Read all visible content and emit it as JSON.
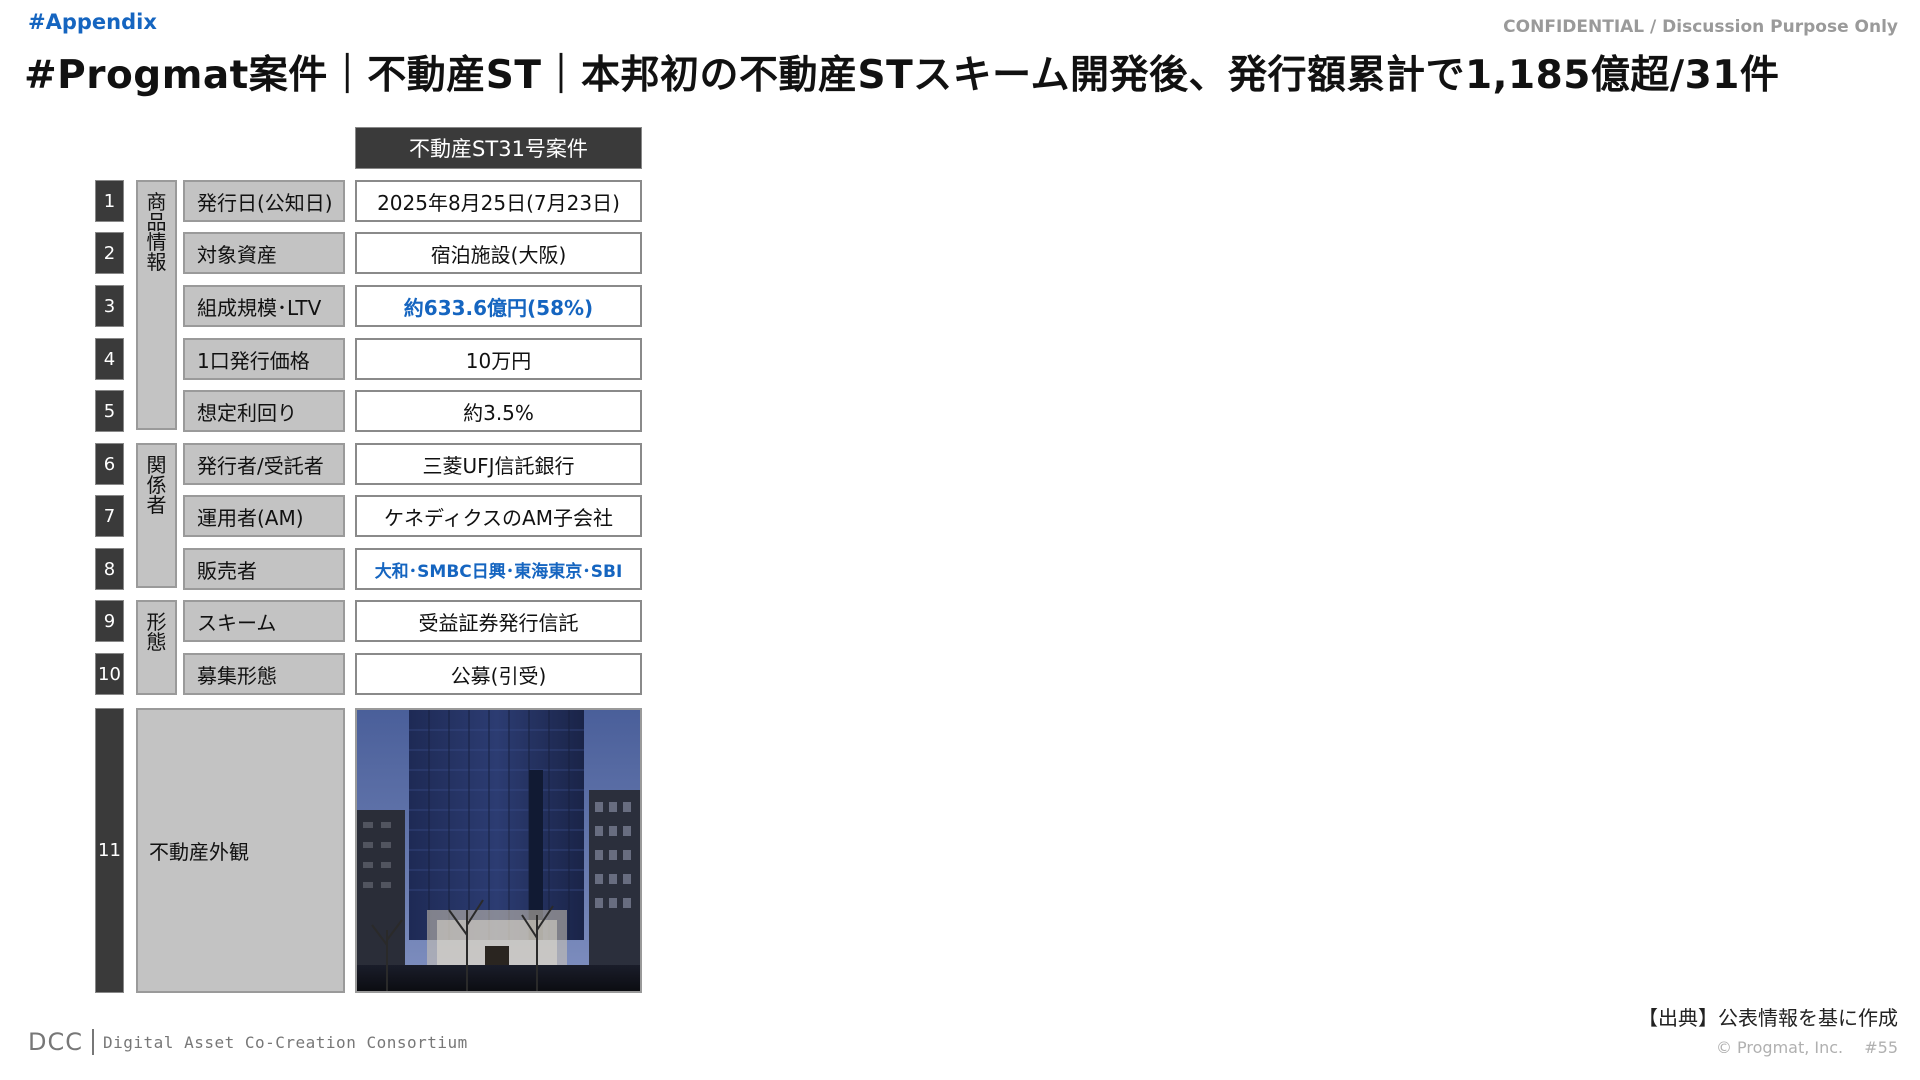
{
  "header": {
    "tag": "#Appendix",
    "confidential": "CONFIDENTIAL / Discussion Purpose Only",
    "title": "#Progmat案件｜不動産ST｜本邦初の不動産STスキーム開発後、発行額累計で1,185億超/31件"
  },
  "table": {
    "column_header": "不動産ST31号案件",
    "groups": [
      {
        "label": "商品情報"
      },
      {
        "label": "関係者"
      },
      {
        "label": "形態"
      }
    ],
    "rows": [
      {
        "no": "1",
        "label": "発行日(公知日)",
        "value": "2025年8月25日(7月23日)"
      },
      {
        "no": "2",
        "label": "対象資産",
        "value": "宿泊施設(大阪)"
      },
      {
        "no": "3",
        "label": "組成規模･LTV",
        "value": "約633.6億円(58%)"
      },
      {
        "no": "4",
        "label": "1口発行価格",
        "value": "10万円"
      },
      {
        "no": "5",
        "label": "想定利回り",
        "value": "約3.5%"
      },
      {
        "no": "6",
        "label": "発行者/受託者",
        "value": "三菱UFJ信託銀行"
      },
      {
        "no": "7",
        "label": "運用者(AM)",
        "value": "ケネディクスのAM子会社"
      },
      {
        "no": "8",
        "label": "販売者",
        "value": "大和･SMBC日興･東海東京･SBI"
      },
      {
        "no": "9",
        "label": "スキーム",
        "value": "受益証券発行信託"
      },
      {
        "no": "10",
        "label": "募集形態",
        "value": "公募(引受)"
      }
    ],
    "image_row": {
      "no": "11",
      "label": "不動産外観"
    },
    "accent_color": "#1565c0"
  },
  "footer": {
    "source": "【出典】公表情報を基に作成",
    "copyright": "© Progmat, Inc.　 #55",
    "logo_abbr": "DCC",
    "logo_name": "Digital Asset Co-Creation Consortium"
  }
}
